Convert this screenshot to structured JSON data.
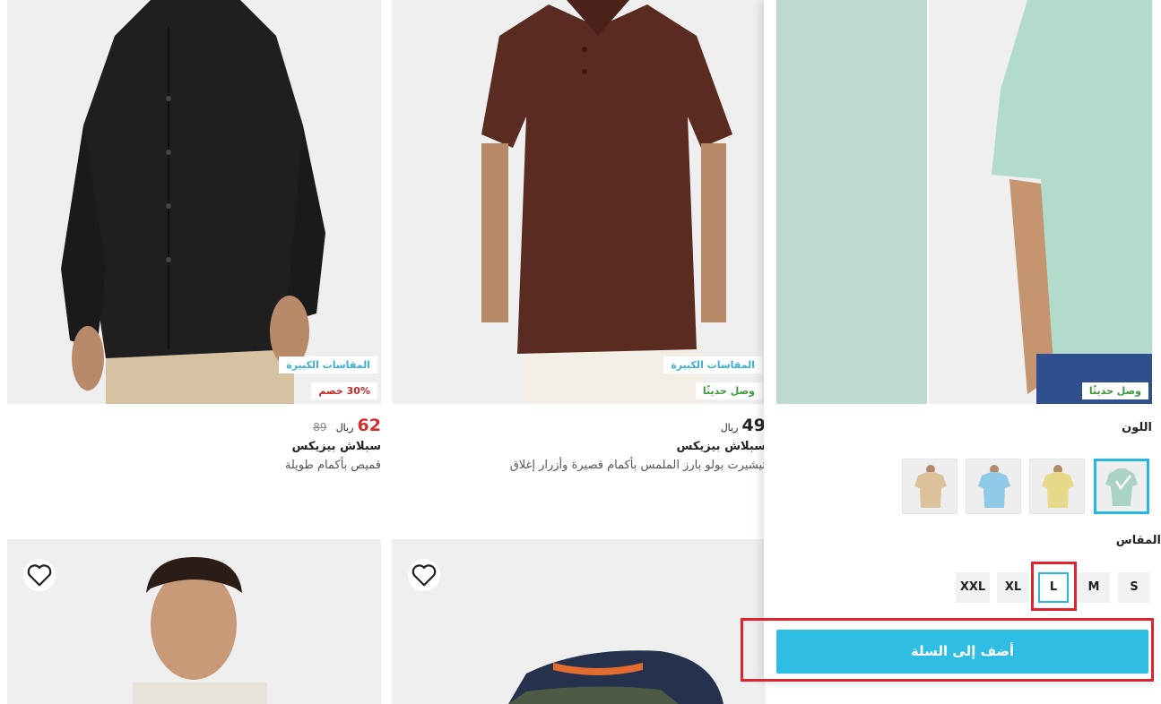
{
  "products": [
    {
      "badges": [
        "المقاسات الكبيرة",
        "30% خصم"
      ],
      "price": "62",
      "currency": "ريال",
      "old_price": "89",
      "brand": "سبلاش بيزيكس",
      "name": "قميص بأكمام طويلة",
      "image_icon": "black-shirt-photo"
    },
    {
      "badges": [
        "المقاسات الكبيرة",
        "وصل حديثًا"
      ],
      "price": "49",
      "currency": "ريال",
      "brand": "سبلاش بيزيكس",
      "name": "تيشيرت بولو بارز الملمس بأكمام قصيرة وأزرار إغلاق",
      "image_icon": "brown-polo-photo"
    },
    {
      "image_icon": "man-portrait-photo"
    },
    {
      "image_icon": "tshirts-stack-photo"
    }
  ],
  "quick_view": {
    "badge": "وصل حديثًا",
    "color_label": "اللون",
    "size_label": "المقاس",
    "sizes": [
      "S",
      "M",
      "L",
      "XL",
      "XXL"
    ],
    "selected_size": "L",
    "colors": [
      {
        "name": "mint",
        "hex": "#b9dacb",
        "selected": true
      },
      {
        "name": "yellow",
        "hex": "#e9d98a",
        "selected": false
      },
      {
        "name": "light-blue",
        "hex": "#8fcbe6",
        "selected": false
      },
      {
        "name": "beige",
        "hex": "#dcc29a",
        "selected": false
      }
    ],
    "add_to_cart": "أضف إلى السلة"
  },
  "colors": {
    "accent": "#2fbde4",
    "highlight": "#e0242f",
    "sale": "#d32f2f"
  }
}
